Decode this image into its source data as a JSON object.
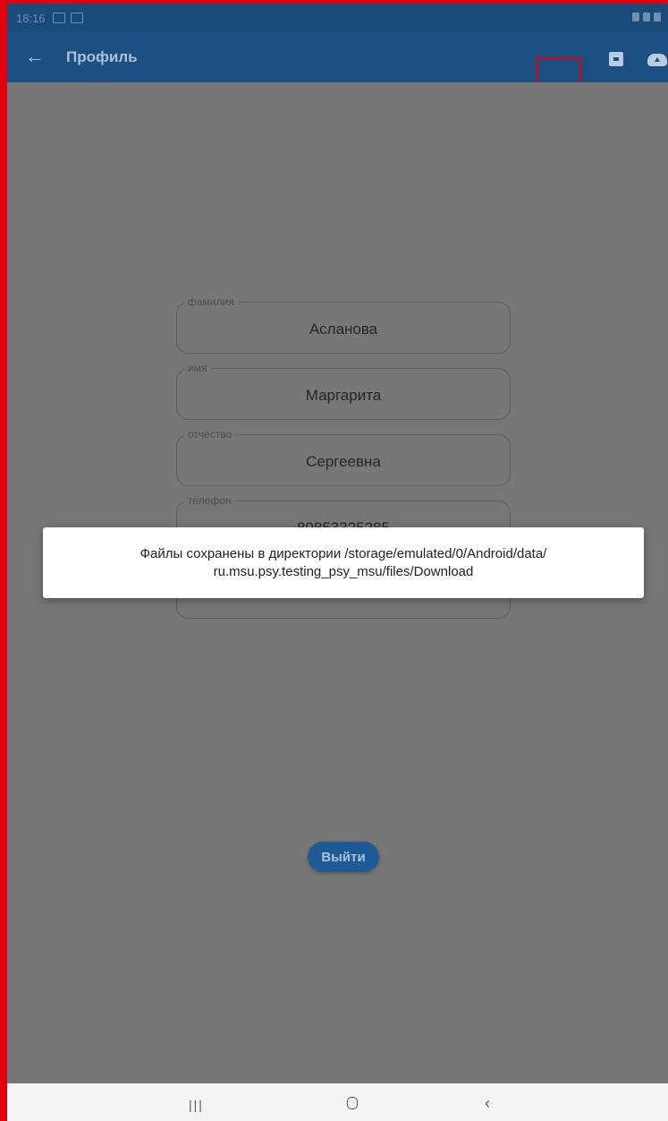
{
  "statusbar": {
    "time": "18:16"
  },
  "appbar": {
    "back_icon": "←",
    "title": "Профиль",
    "actions": [
      "save-icon",
      "cloud-upload-icon"
    ]
  },
  "profile": {
    "fields": [
      {
        "label": "фамилия",
        "value": "Асланова"
      },
      {
        "label": "имя",
        "value": "Маргарита"
      },
      {
        "label": "отчество",
        "value": "Сергеевна"
      },
      {
        "label": "телефон",
        "value": "89853325285"
      }
    ],
    "logout_label": "Выйти"
  },
  "snackbar": {
    "line1": "Файлы сохранены в директории /storage/emulated/0/Android/data/",
    "line2": "ru.msu.psy.testing_psy_msu/files/Download"
  },
  "navbar": {
    "recents_icon": "|||",
    "back_icon": "‹"
  },
  "colors": {
    "appbar": "#1e4f82",
    "overlay": "#777777",
    "highlight": "#e0000e",
    "button": "#1e5a96"
  }
}
